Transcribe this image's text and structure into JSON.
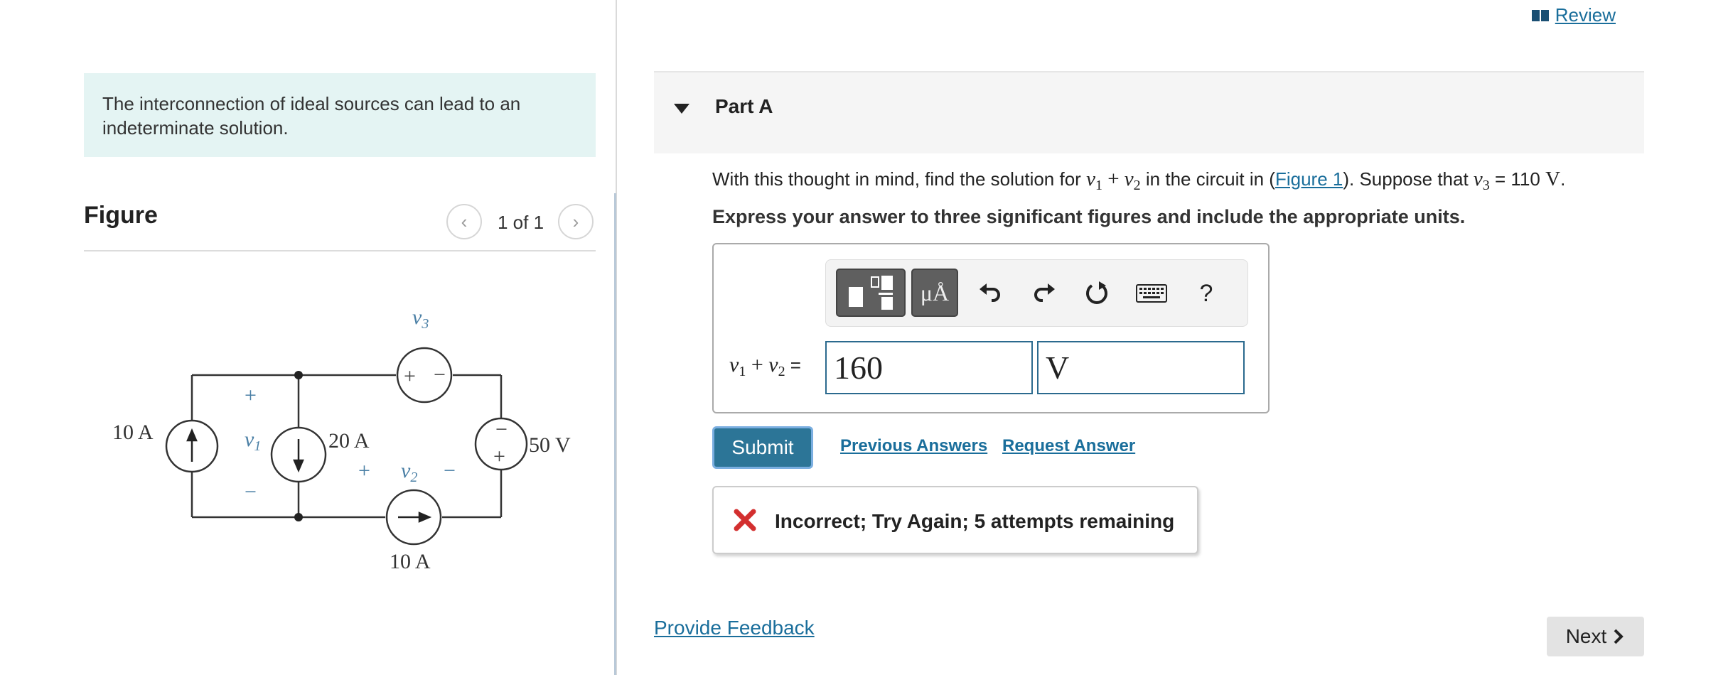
{
  "left_pane": {
    "intro_text": "The interconnection of ideal sources can lead to an indeterminate solution.",
    "figure_title": "Figure",
    "figure_counter": "1 of 1",
    "circuit_labels": {
      "current_source_left": "10 A",
      "current_source_middle": "20 A",
      "current_source_bottom": "10 A",
      "voltage_source_right": "50 V",
      "v1_label": "v",
      "v1_sub": "1",
      "v2_label": "v",
      "v2_sub": "2",
      "v3_label": "v",
      "v3_sub": "3",
      "plus_sign": "+",
      "minus_sign": "−"
    }
  },
  "header": {
    "review_label": "Review"
  },
  "part": {
    "label": "Part A",
    "question_prefix": "With this thought in mind, find the solution for ",
    "question_var1": "v",
    "question_sub1": "1",
    "question_plus": " + ",
    "question_var2": "v",
    "question_sub2": "2",
    "question_mid": " in the circuit in (",
    "figure_link": "Figure 1",
    "question_suffix": "). Suppose that ",
    "question_var3": "v",
    "question_sub3": "3",
    "question_eq": " = 110 ",
    "question_unit": "V",
    "question_end": ".",
    "instructions": "Express your answer to three significant figures and include the appropriate units."
  },
  "answer": {
    "label_var1": "v",
    "label_sub1": "1",
    "label_plus": " + ",
    "label_var2": "v",
    "label_sub2": "2",
    "label_eq": " = ",
    "value": "160",
    "unit": "V",
    "units_button_label": "μÅ",
    "help_label": "?"
  },
  "actions": {
    "submit_label": "Submit",
    "previous_answers_label": "Previous Answers",
    "request_answer_label": "Request Answer"
  },
  "feedback": {
    "message": "Incorrect; Try Again; 5 attempts remaining",
    "status_color": "#d32f2f"
  },
  "footer": {
    "provide_feedback_label": "Provide Feedback",
    "next_label": "Next"
  },
  "colors": {
    "link": "#1a6e9b",
    "submit_bg": "#2c7597",
    "intro_bg": "#e4f4f3",
    "circuit_label": "#4a7fa5"
  }
}
